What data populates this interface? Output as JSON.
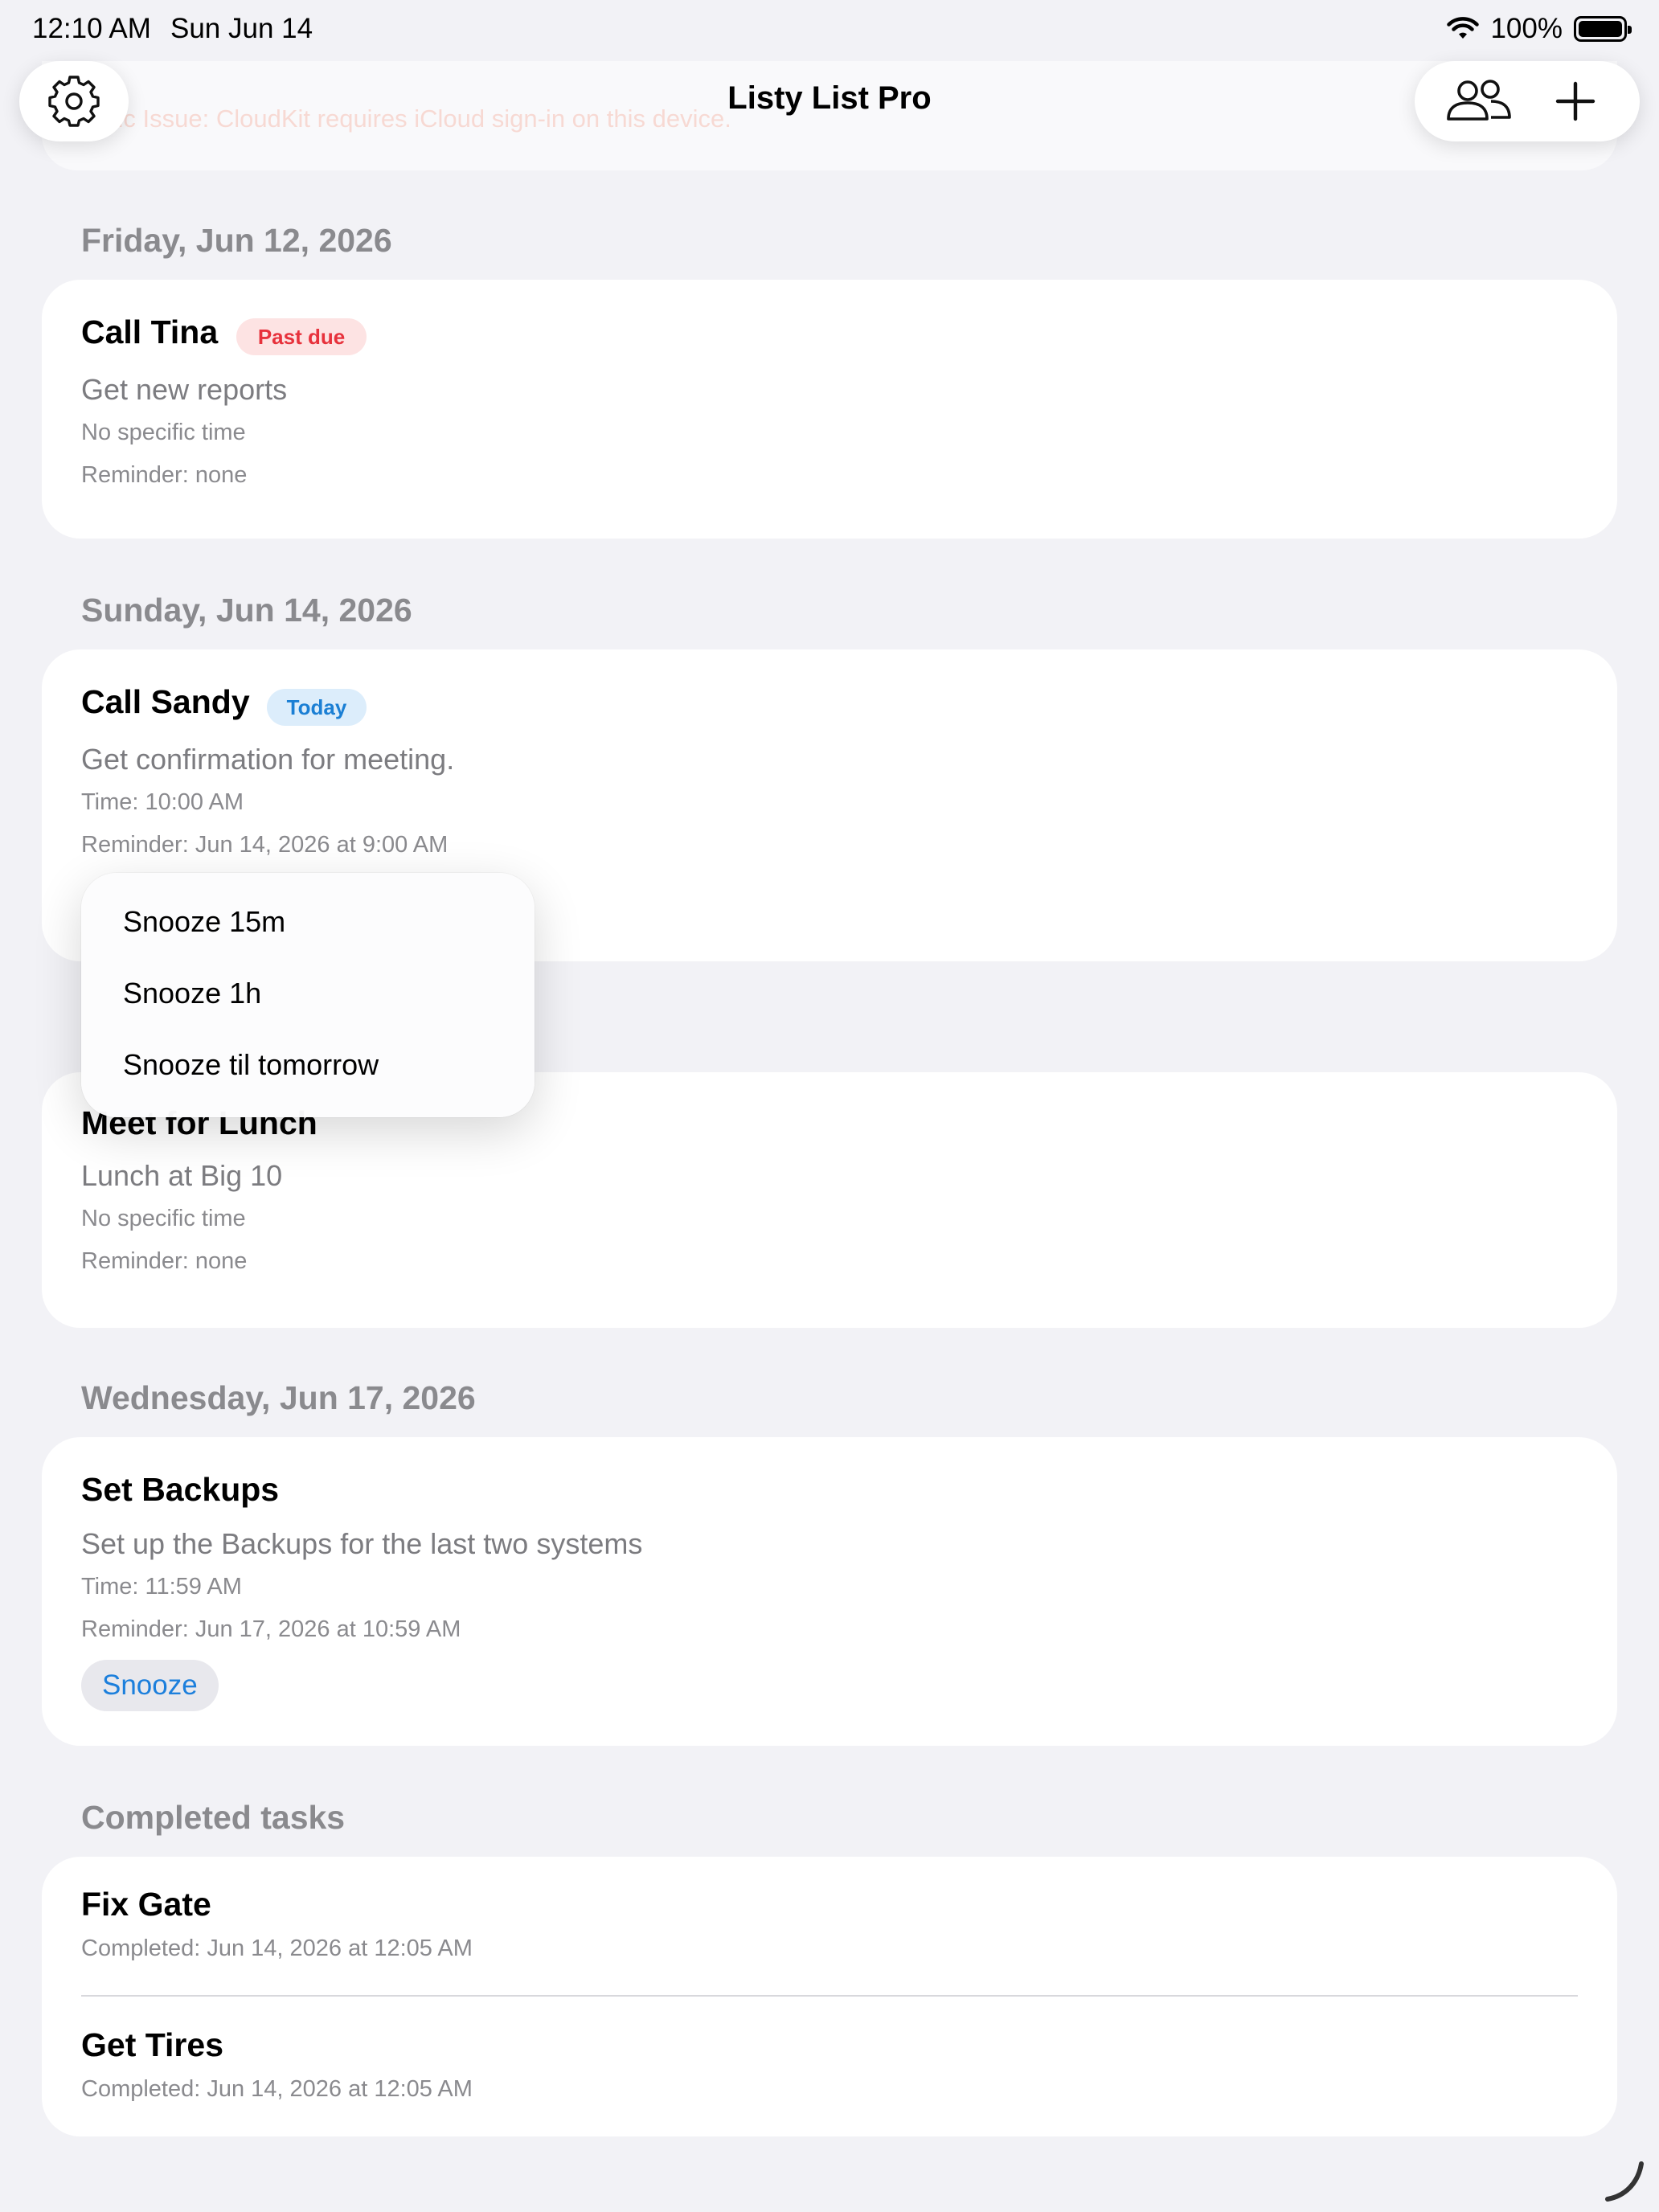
{
  "status_bar": {
    "time": "12:10 AM",
    "date": "Sun Jun 14",
    "battery": "100%",
    "wifi_icon": "wifi-icon",
    "battery_icon": "battery-icon"
  },
  "sync_banner": {
    "text": "Sync Issue: CloudKit requires iCloud sign-in on this device."
  },
  "toolbar": {
    "title": "Listy List Pro",
    "settings_icon": "gear-icon",
    "share_icon": "people-icon",
    "add_icon": "plus-icon"
  },
  "sections": [
    {
      "header": "Friday, Jun 12, 2026",
      "tasks": [
        {
          "title": "Call Tina",
          "badge": "Past due",
          "note": "Get new reports",
          "time": "No specific time",
          "reminder": "Reminder: none"
        }
      ]
    },
    {
      "header": "Sunday, Jun 14, 2026",
      "tasks": [
        {
          "title": "Call Sandy",
          "badge": "Today",
          "note": "Get confirmation for meeting.",
          "time": "Time: 10:00 AM",
          "reminder": "Reminder: Jun 14, 2026 at 9:00 AM"
        }
      ]
    },
    {
      "header": "",
      "tasks": [
        {
          "title": "Meet for Lunch",
          "note": "Lunch at Big 10",
          "time": "No specific time",
          "reminder": "Reminder: none"
        }
      ]
    },
    {
      "header": "Wednesday, Jun 17, 2026",
      "tasks": [
        {
          "title": "Set Backups",
          "note": "Set up the Backups for the last two systems",
          "time": "Time: 11:59 AM",
          "reminder": "Reminder: Jun 17, 2026 at 10:59 AM",
          "snooze_label": "Snooze"
        }
      ]
    }
  ],
  "completed": {
    "header": "Completed tasks",
    "tasks": [
      {
        "title": "Fix Gate",
        "completed": "Completed: Jun 14, 2026 at 12:05 AM"
      },
      {
        "title": "Get Tires",
        "completed": "Completed: Jun 14, 2026 at 12:05 AM"
      }
    ]
  },
  "snooze_menu": {
    "items": [
      "Snooze 15m",
      "Snooze 1h",
      "Snooze til tomorrow"
    ]
  },
  "colors": {
    "background": "#f2f2f6",
    "past_due": "#e7323c",
    "today": "#1b7fd4",
    "accent": "#1c7fdc"
  }
}
